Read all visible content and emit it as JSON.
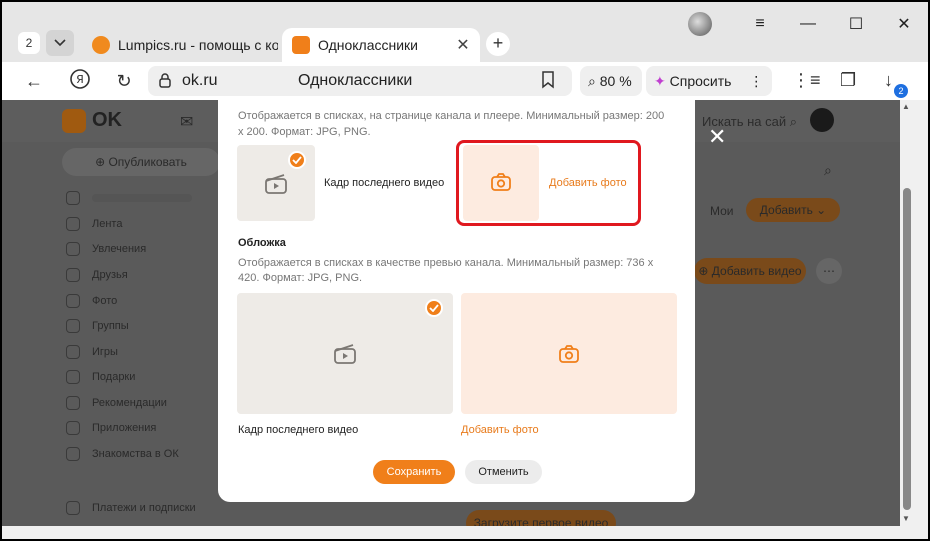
{
  "browser": {
    "tab_count": "2",
    "tabs": [
      {
        "title": "Lumpics.ru - помощь с ком",
        "favicon_color": "#f08a1e"
      },
      {
        "title": "Одноклассники",
        "favicon_color": "#f07f1a"
      }
    ],
    "address": {
      "url": "ok.ru",
      "page_title": "Одноклассники"
    },
    "zoom": "80 %",
    "ask_label": "Спросить",
    "downloads_badge": "2"
  },
  "page_bg": {
    "search_placeholder": "Искать на сай",
    "publish_label": "Опубликовать",
    "sidebar": [
      "Лента",
      "Увлечения",
      "Друзья",
      "Фото",
      "Группы",
      "Игры",
      "Подарки",
      "Рекомендации",
      "Приложения",
      "Знакомства в ОК"
    ],
    "sidebar_bottom": "Платежи и подписки",
    "mine_label": "Мои",
    "add_label": "Добавить",
    "add_video_label": "Добавить видео",
    "upload_first_label": "Загрузите первое видео"
  },
  "modal": {
    "avatar_desc_1": "Отображается в списках, на странице канала и плеере. Минимальный размер: 200",
    "avatar_desc_2": "х 200. Формат: JPG, PNG.",
    "avatar_frame_label": "Кадр последнего видео",
    "add_photo_label": "Добавить фото",
    "cover_heading": "Обложка",
    "cover_desc_1": "Отображается в списках в качестве превью канала. Минимальный размер: 736 х",
    "cover_desc_2": "420. Формат: JPG, PNG.",
    "cover_frame_label": "Кадр последнего видео",
    "cover_add_label": "Добавить фото",
    "save_label": "Сохранить",
    "cancel_label": "Отменить"
  },
  "colors": {
    "accent": "#f07f1a",
    "highlight": "#e0181f"
  }
}
